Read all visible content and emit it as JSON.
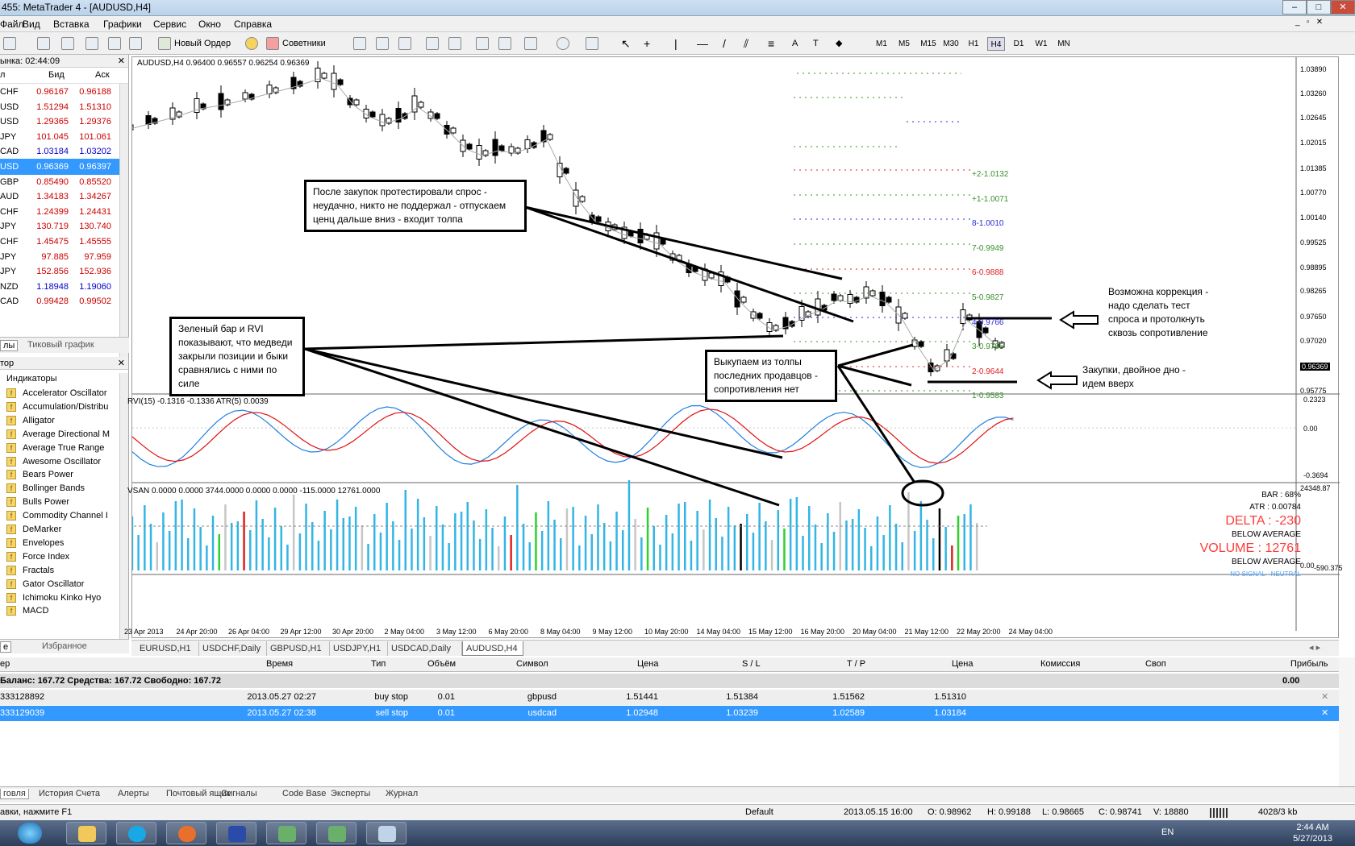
{
  "window": {
    "title": "455: MetaTrader 4 - [AUDUSD,H4]"
  },
  "menu": [
    "Файл",
    "Вид",
    "Вставка",
    "Графики",
    "Сервис",
    "Окно",
    "Справка"
  ],
  "toolbar": {
    "new_order": "Новый Ордер",
    "advisors": "Советники",
    "timeframes": [
      "M1",
      "M5",
      "M15",
      "M30",
      "H1",
      "H4",
      "D1",
      "W1",
      "MN"
    ],
    "active_timeframe": "H4"
  },
  "market_watch": {
    "title": "ынка: 02:44:09",
    "col_symbol": "л",
    "col_bid": "Бид",
    "col_ask": "Аск",
    "rows": [
      {
        "symbol": "CHF",
        "bid": "0.96167",
        "ask": "0.96188"
      },
      {
        "symbol": "USD",
        "bid": "1.51294",
        "ask": "1.51310"
      },
      {
        "symbol": "USD",
        "bid": "1.29365",
        "ask": "1.29376"
      },
      {
        "symbol": "JPY",
        "bid": "101.045",
        "ask": "101.061"
      },
      {
        "symbol": "CAD",
        "bid": "1.03184",
        "ask": "1.03202"
      },
      {
        "symbol": "USD",
        "bid": "0.96369",
        "ask": "0.96397"
      },
      {
        "symbol": "GBP",
        "bid": "0.85490",
        "ask": "0.85520"
      },
      {
        "symbol": "AUD",
        "bid": "1.34183",
        "ask": "1.34267"
      },
      {
        "symbol": "CHF",
        "bid": "1.24399",
        "ask": "1.24431"
      },
      {
        "symbol": "JPY",
        "bid": "130.719",
        "ask": "130.740"
      },
      {
        "symbol": "CHF",
        "bid": "1.45475",
        "ask": "1.45555"
      },
      {
        "symbol": "JPY",
        "bid": "97.885",
        "ask": "97.959"
      },
      {
        "symbol": "JPY",
        "bid": "152.856",
        "ask": "152.936"
      },
      {
        "symbol": "NZD",
        "bid": "1.18948",
        "ask": "1.19060"
      },
      {
        "symbol": "CAD",
        "bid": "0.99428",
        "ask": "0.99502"
      }
    ],
    "tabs": [
      "лы",
      "Тиковый график"
    ]
  },
  "navigator": {
    "title": "тор",
    "root": "Индикаторы",
    "items": [
      "Accelerator Oscillator",
      "Accumulation/Distribu",
      "Alligator",
      "Average Directional M",
      "Average True Range",
      "Awesome Oscillator",
      "Bears Power",
      "Bollinger Bands",
      "Bulls Power",
      "Commodity Channel I",
      "DeMarker",
      "Envelopes",
      "Force Index",
      "Fractals",
      "Gator Oscillator",
      "Ichimoku Kinko Hyo",
      "MACD"
    ],
    "tabs": [
      "е",
      "Избранное"
    ]
  },
  "chart": {
    "header": "AUDUSD,H4  0.96400 0.96557 0.96254 0.96369",
    "rvi_header": "RVI(15) -0.1316 -0.1336  ATR(5) 0.0039",
    "vsan_header": "VSAN 0.0000 0.0000 3744.0000 0.0000 0.0000 -115.0000 12761.0000",
    "price_labels": [
      "1.03890",
      "1.03260",
      "1.02645",
      "1.02015",
      "1.01385",
      "1.00770",
      "1.00140",
      "0.99525",
      "0.98895",
      "0.98265",
      "0.97650",
      "0.97020",
      "0.96369",
      "0.95775"
    ],
    "current_price": "0.96369",
    "rvi_labels": [
      "0.2323",
      "0.00",
      "-0.3694"
    ],
    "vsan_labels": [
      "24348.87",
      "0.00",
      "-590.375"
    ],
    "date_labels": [
      "23 Apr 2013",
      "24 Apr 20:00",
      "26 Apr 04:00",
      "29 Apr 12:00",
      "30 Apr 20:00",
      "2 May 04:00",
      "3 May 12:00",
      "6 May 20:00",
      "8 May 04:00",
      "9 May 12:00",
      "10 May 20:00",
      "14 May 04:00",
      "15 May 12:00",
      "16 May 20:00",
      "20 May 04:00",
      "21 May 12:00",
      "22 May 20:00",
      "24 May 04:00"
    ],
    "fib_labels": [
      "+2-1.0132",
      "+1-1.0071",
      "8-1.0010",
      "7-0.9949",
      "6-0.9888",
      "5-0.9827",
      "4-0.9766",
      "3-0.9705",
      "2-0.9644",
      "1-0.9583"
    ],
    "vsan_info": {
      "bar": "BAR : 68%",
      "atr": "ATR : 0.00784",
      "delta": "DELTA : -230",
      "below1": "BELOW AVERAGE",
      "volume": "VOLUME : 12761",
      "below2": "BELOW AVERAGE",
      "signal": "NO SIGNAL - NEUTRAL"
    },
    "annotations": {
      "a1": "После закупок протестировали спрос - неудачно, никто не поддержал - отпускаем ценц дальше вниз - входит толпа",
      "a2": "Зеленый бар и RVI показывают, что медведи закрыли позиции и быки сравнялись с ними по силе",
      "a3": "Выкупаем из толпы последних продавцов - сопротивления нет",
      "a4": "Возможна коррекция - надо сделать тест спроса и протолкнуть сквозь сопротивление",
      "a5": "Закупки, двойное дно - идем вверх"
    }
  },
  "chart_tabs": [
    "EURUSD,H1",
    "USDCHF,Daily",
    "GBPUSD,H1",
    "USDJPY,H1",
    "USDCAD,Daily",
    "AUDUSD,H4"
  ],
  "active_chart_tab": "AUDUSD,H4",
  "terminal": {
    "headers": [
      "ер",
      "Время",
      "Тип",
      "Объём",
      "Символ",
      "Цена",
      "S / L",
      "T / P",
      "Цена",
      "Комиссия",
      "Своп",
      "Прибыль"
    ],
    "balance": "Баланс: 167.72  Средства: 167.72  Свободно: 167.72",
    "balance_profit": "0.00",
    "orders": [
      {
        "ticket": "333128892",
        "time": "2013.05.27 02:27",
        "type": "buy stop",
        "volume": "0.01",
        "symbol": "gbpusd",
        "price": "1.51441",
        "sl": "1.51384",
        "tp": "1.51562",
        "cur": "1.51310"
      },
      {
        "ticket": "333129039",
        "time": "2013.05.27 02:38",
        "type": "sell stop",
        "volume": "0.01",
        "symbol": "usdcad",
        "price": "1.02948",
        "sl": "1.03239",
        "tp": "1.02589",
        "cur": "1.03184"
      }
    ],
    "tabs": [
      "говля",
      "История Счета",
      "Алерты",
      "Почтовый ящик",
      "Сигналы",
      "Code Base",
      "Эксперты",
      "Журнал"
    ]
  },
  "status": {
    "help": "авки, нажмите F1",
    "profile": "Default",
    "datetime": "2013.05.15 16:00",
    "open": "O: 0.98962",
    "high": "H: 0.99188",
    "low": "L: 0.98665",
    "close": "C: 0.98741",
    "volume": "V: 18880",
    "traffic": "4028/3 kb"
  },
  "taskbar": {
    "lang": "EN",
    "time": "2:44 AM",
    "date": "5/27/2013"
  }
}
